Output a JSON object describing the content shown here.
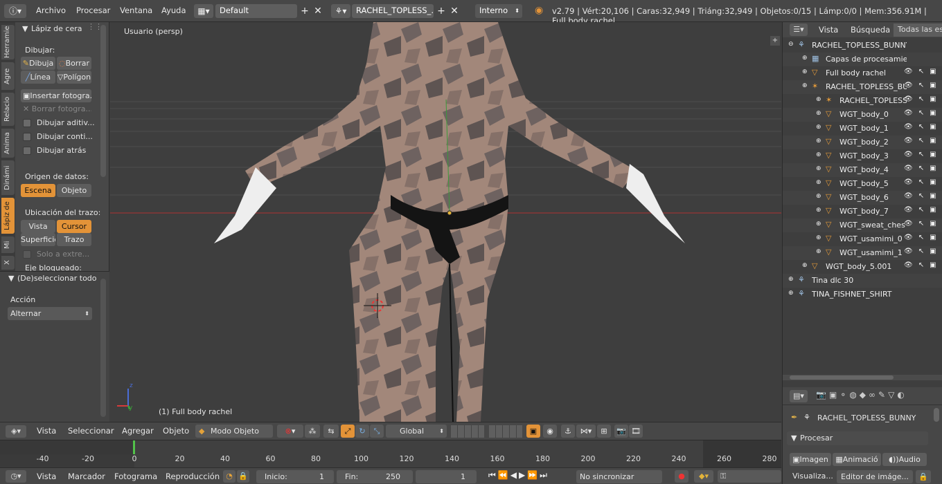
{
  "topbar": {
    "menus": [
      "Archivo",
      "Procesar",
      "Ventana",
      "Ayuda"
    ],
    "screen_layout": "Default",
    "scene": "RACHEL_TOPLESS_...",
    "engine": "Interno",
    "stats": "v2.79 | Vért:20,106 | Caras:32,949 | Triáng:32,949 | Objetos:0/15 | Lámp:0/0 | Mem:356.91M | Full body rachel"
  },
  "tool_tabs": [
    "Herramie",
    "Agre",
    "Relacio",
    "Anima",
    "Dinámi",
    "Lápiz de",
    "Mi",
    "X"
  ],
  "toolshelf": {
    "panel_title": "Lápiz de cera",
    "draw_label": "Dibujar:",
    "draw_button": "Dibuja",
    "erase_button": "Borrar",
    "line_button": "Línea",
    "poly_button": "Polígon",
    "insert_frame": "Insertar fotogra...",
    "delete_frame": "Borrar fotogra...",
    "check_additive": "Dibujar aditiv...",
    "check_continuous": "Dibujar conti...",
    "check_behind": "Dibujar atrás",
    "data_source_label": "Origen de datos:",
    "source_scene": "Escena",
    "source_object": "Objeto",
    "stroke_place_label": "Ubicación del trazo:",
    "place_view": "Vista",
    "place_cursor": "Cursor",
    "place_surface": "Superficie",
    "place_stroke": "Trazo",
    "only_extra": "Solo a extre...",
    "axis_locked": "Eje bloqueado:",
    "operator_title": "(De)seleccionar todo",
    "action_label": "Acción",
    "action_value": "Alternar"
  },
  "viewport": {
    "view_label": "Usuario (persp)",
    "object_label": "(1) Full body rachel"
  },
  "outliner": {
    "tabs": [
      "Vista",
      "Búsqueda",
      "Todas las esc"
    ],
    "rows": [
      {
        "name": "RACHEL_TOPLESS_BUNNY",
        "indent": 0,
        "icon": "scene-icon"
      },
      {
        "name": "Capas de procesamien",
        "indent": 1,
        "icon": "render-layers-icon"
      },
      {
        "name": "Full body rachel",
        "indent": 1,
        "icon": "mesh-icon"
      },
      {
        "name": "RACHEL_TOPLESS_BU",
        "indent": 1,
        "icon": "armature-icon"
      },
      {
        "name": "RACHEL_TOPLESS",
        "indent": 2,
        "icon": "armature-icon"
      },
      {
        "name": "WGT_body_0",
        "indent": 2,
        "icon": "mesh-icon"
      },
      {
        "name": "WGT_body_1",
        "indent": 2,
        "icon": "mesh-icon"
      },
      {
        "name": "WGT_body_2",
        "indent": 2,
        "icon": "mesh-icon"
      },
      {
        "name": "WGT_body_3",
        "indent": 2,
        "icon": "mesh-icon"
      },
      {
        "name": "WGT_body_4",
        "indent": 2,
        "icon": "mesh-icon"
      },
      {
        "name": "WGT_body_5",
        "indent": 2,
        "icon": "mesh-icon"
      },
      {
        "name": "WGT_body_6",
        "indent": 2,
        "icon": "mesh-icon"
      },
      {
        "name": "WGT_body_7",
        "indent": 2,
        "icon": "mesh-icon"
      },
      {
        "name": "WGT_sweat_ches",
        "indent": 2,
        "icon": "mesh-icon"
      },
      {
        "name": "WGT_usamimi_0",
        "indent": 2,
        "icon": "mesh-icon"
      },
      {
        "name": "WGT_usamimi_1",
        "indent": 2,
        "icon": "mesh-icon"
      },
      {
        "name": "WGT_body_5.001",
        "indent": 1,
        "icon": "mesh-icon"
      },
      {
        "name": "Tina dlc 30",
        "indent": 0,
        "icon": "scene-icon"
      },
      {
        "name": "TINA_FISHNET_SHIRT",
        "indent": 0,
        "icon": "scene-icon"
      }
    ]
  },
  "properties": {
    "breadcrumb": "RACHEL_TOPLESS_BUNNY",
    "panel": "Procesar",
    "btn_image": "Imagen",
    "btn_anim": "Animació",
    "btn_audio": "Audio",
    "display_label": "Visualiza...",
    "display_value": "Editor de imáge..."
  },
  "view3d_header": {
    "menus": [
      "Vista",
      "Seleccionar",
      "Agregar",
      "Objeto"
    ],
    "mode": "Modo Objeto",
    "orientation": "Global"
  },
  "timeline": {
    "ticks": [
      "-40",
      "-20",
      "0",
      "20",
      "40",
      "60",
      "80",
      "100",
      "120",
      "140",
      "160",
      "180",
      "200",
      "220",
      "240",
      "260",
      "280"
    ],
    "current_frame_marker": 0
  },
  "timeline_header": {
    "menus": [
      "Vista",
      "Marcador",
      "Fotograma",
      "Reproducción"
    ],
    "start_label": "Inicio:",
    "start_value": "1",
    "end_label": "Fin:",
    "end_value": "250",
    "current": "1",
    "sync": "No sincronizar"
  },
  "colors": {
    "accent": "#e39338",
    "bg": "#3d3d3d",
    "panel": "#474747"
  }
}
